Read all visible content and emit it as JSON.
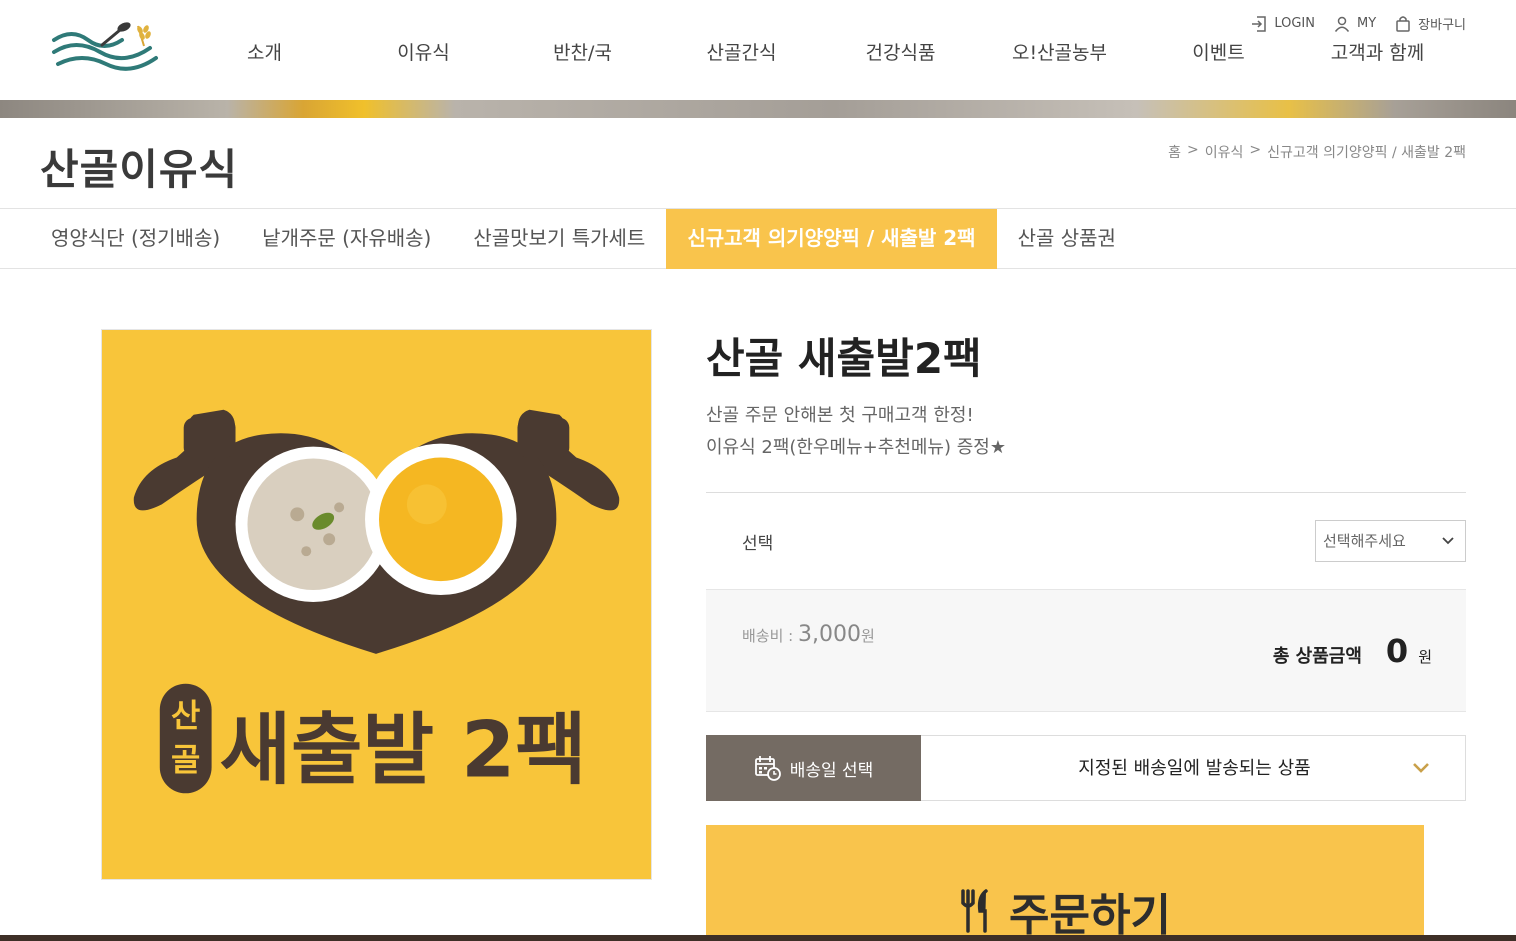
{
  "header": {
    "util": {
      "login": "LOGIN",
      "my": "MY",
      "cart": "장바구니"
    },
    "nav": [
      "소개",
      "이유식",
      "반찬/국",
      "산골간식",
      "건강식품",
      "오!산골농부",
      "이벤트",
      "고객과 함께"
    ]
  },
  "category": {
    "title": "산골이유식",
    "breadcrumb": [
      "홈",
      ">",
      "이유식",
      ">",
      "신규고객 의기양양픽 / 새출발 2팩"
    ]
  },
  "subnav": [
    {
      "label": "영양식단 (정기배송)",
      "active": false
    },
    {
      "label": "낱개주문 (자유배송)",
      "active": false
    },
    {
      "label": "산골맛보기 특가세트",
      "active": false
    },
    {
      "label": "신규고객 의기양양픽 / 새출발 2팩",
      "active": true
    },
    {
      "label": "산골 상품권",
      "active": false
    }
  ],
  "product": {
    "image_text": {
      "badge": "산골",
      "name": "새출발 2팩"
    },
    "title": "산골 새출발2팩",
    "desc_line1": "산골 주문 안해본 첫 구매고객 한정!",
    "desc_line2": "이유식 2팩(한우메뉴+추천메뉴) 증정★",
    "option_label": "선택",
    "option_placeholder": "선택해주세요",
    "shipping_label": "배송비 : ",
    "shipping_value": "3,000",
    "shipping_unit": "원",
    "total_label": "총 상품금액",
    "total_value": "0",
    "total_unit": "원",
    "delivery_button": "배송일 선택",
    "delivery_text": "지정된 배송일에 발송되는 상품",
    "order_button": "주문하기"
  },
  "colors": {
    "accent": "#f9c44c",
    "delivery_button": "#746b63",
    "logo_teal": "#2f7a78",
    "logo_brown": "#5a3a2c"
  }
}
